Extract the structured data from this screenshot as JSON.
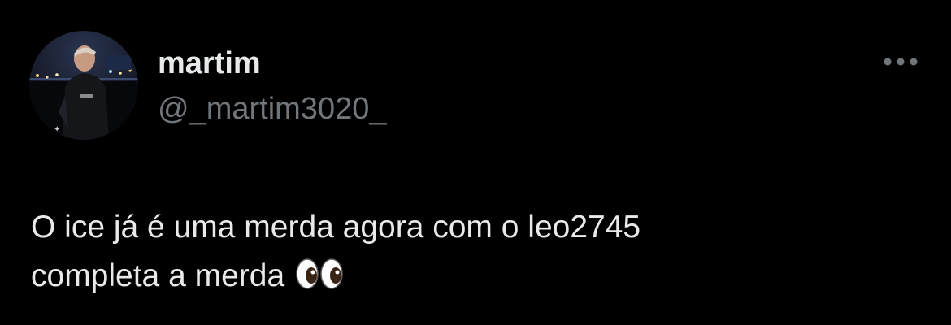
{
  "author": {
    "display_name": "martim",
    "handle": "@_martim3020_",
    "avatar_icon": "profile-photo"
  },
  "more_icon": "more-horizontal-icon",
  "tweet": {
    "line1": "O ice já é uma merda agora com o leo2745",
    "line2": "completa a merda",
    "emoji": "eyes-emoji"
  },
  "colors": {
    "background": "#000000",
    "primary_text": "#e7e9ea",
    "secondary_text": "#71767b"
  }
}
